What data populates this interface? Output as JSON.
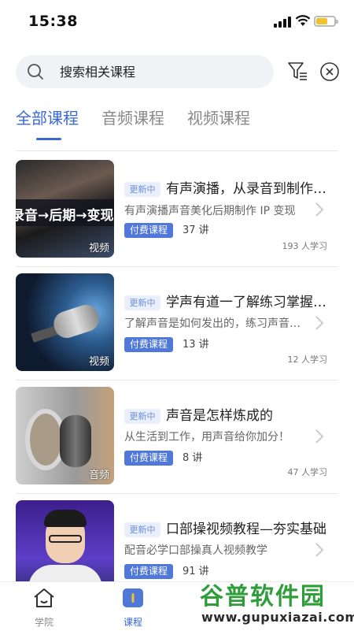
{
  "status_bar": {
    "time": "15:38"
  },
  "search": {
    "placeholder": "搜索相关课程"
  },
  "tabs": [
    {
      "label": "全部课程",
      "active": true
    },
    {
      "label": "音频课程",
      "active": false
    },
    {
      "label": "视频课程",
      "active": false
    }
  ],
  "courses": [
    {
      "thumb_text": "录音→后期→变现",
      "media_type": "视频",
      "status": "更新中",
      "title": "有声演播，从录音到制作…",
      "description": "有声演播声音美化后期制作 IP 变现",
      "paid_label": "付费课程",
      "lessons": "37 讲",
      "learners": "193 人学习"
    },
    {
      "media_type": "视频",
      "status": "更新中",
      "title": "学声有道一了解练习掌握…",
      "description": "了解声音是如何发出的，练习声音…",
      "paid_label": "付费课程",
      "lessons": "13 讲",
      "learners": "12 人学习"
    },
    {
      "media_type": "音频",
      "status": "更新中",
      "title": "声音是怎样炼成的",
      "description": "从生活到工作，用声音给你加分！",
      "paid_label": "付费课程",
      "lessons": "8 讲",
      "learners": "47 人学习"
    },
    {
      "status": "更新中",
      "title": "口部操视频教程—夯实基础",
      "description": "配音必学口部操真人视频教学",
      "paid_label": "付费课程",
      "lessons": "91 讲"
    }
  ],
  "tabbar": [
    {
      "label": "学院",
      "icon": "home-icon",
      "active": false
    },
    {
      "label": "课程",
      "icon": "course-icon",
      "active": true
    }
  ],
  "watermark": {
    "main": "谷普软件园",
    "url": "www.gupuxiazai.com"
  },
  "colors": {
    "accent": "#3a68d8",
    "paid_tag": "#4f78d8",
    "status_tag_bg": "#e9effc",
    "watermark": "#2f9e3a"
  }
}
